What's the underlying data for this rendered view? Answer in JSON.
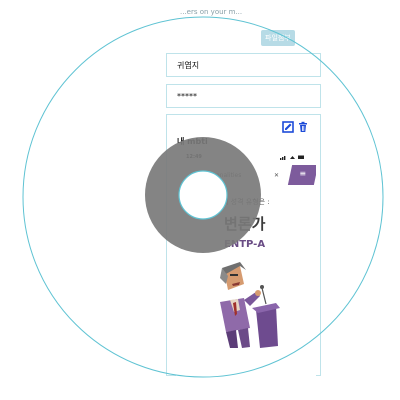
{
  "header": {
    "caption": "...ers on your m...",
    "file_button_label": "파일첨부"
  },
  "form": {
    "name_value": "귀엽지",
    "password_value": "*****"
  },
  "post": {
    "title": "내 mbti",
    "icons": [
      "edit-icon",
      "trash-icon"
    ],
    "screenshot": {
      "time": "12:49",
      "status_icons": "signal wifi battery",
      "brand_fragment": "onalities",
      "close_symbol": "✕",
      "menu_symbol": "≡",
      "intro_text": "의 성격 유형은 :",
      "personality_name": "변론가",
      "personality_code": "ENTP-A"
    }
  },
  "colors": {
    "accent": "#7d5b9c",
    "border": "#bfe3ea",
    "ring": "#5fc3d3",
    "button": "#b7dbe6"
  }
}
